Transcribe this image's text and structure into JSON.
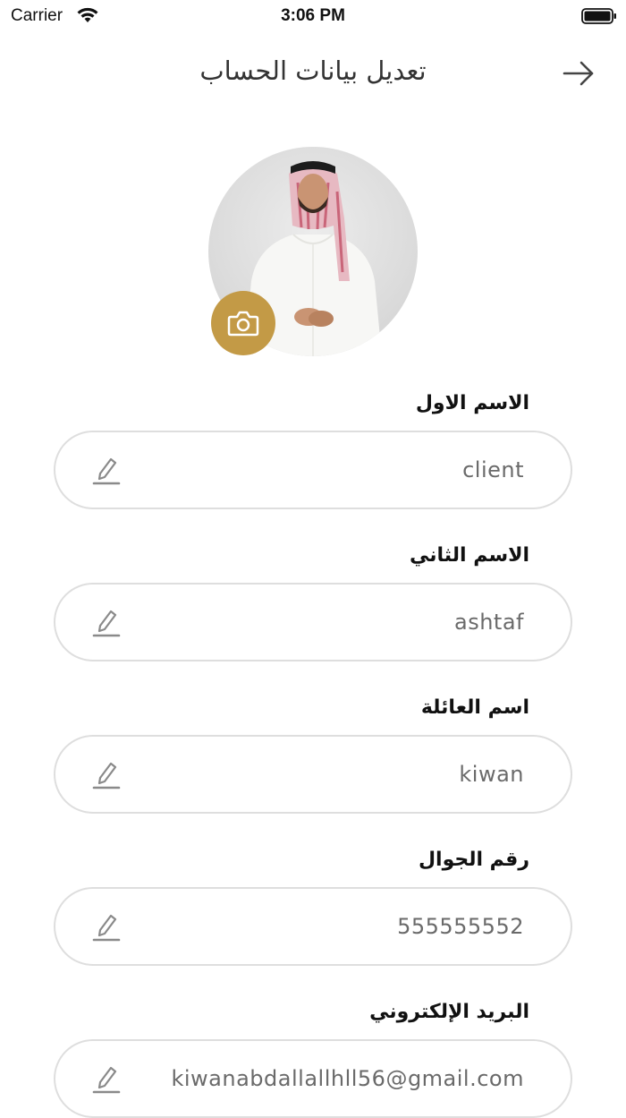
{
  "status_bar": {
    "carrier": "Carrier",
    "time": "3:06 PM",
    "icons": [
      "wifi-icon",
      "battery-icon"
    ]
  },
  "header": {
    "title": "تعديل بيانات الحساب",
    "back_icon": "arrow-right-icon"
  },
  "profile": {
    "avatar": "avatar",
    "camera_icon": "camera-icon",
    "accent_color": "#c39a46"
  },
  "form": {
    "fields": [
      {
        "label": "الاسم الاول",
        "value": "client",
        "icon": "edit-icon"
      },
      {
        "label": "الاسم الثاني",
        "value": "ashtaf",
        "icon": "edit-icon"
      },
      {
        "label": "اسم العائلة",
        "value": "kiwan",
        "icon": "edit-icon"
      },
      {
        "label": "رقم الجوال",
        "value": "555555552",
        "icon": "edit-icon"
      },
      {
        "label": "البريد الإلكتروني",
        "value": "kiwanabdallallhll56@gmail.com",
        "icon": "edit-icon"
      }
    ]
  }
}
